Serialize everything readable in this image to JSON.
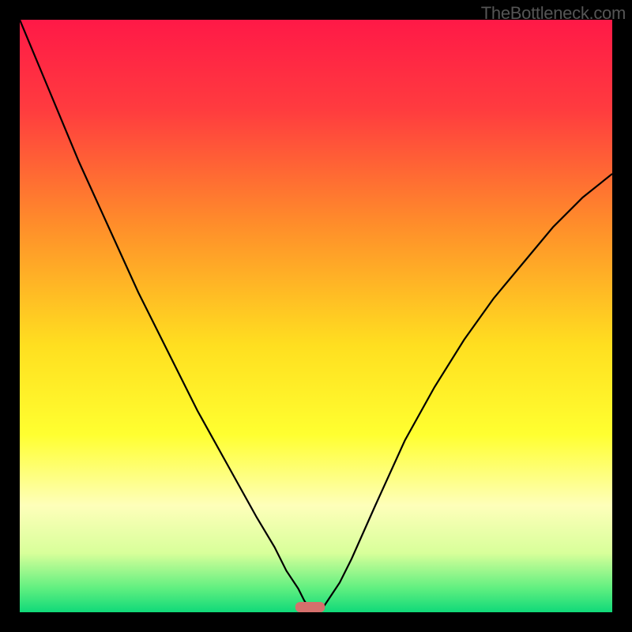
{
  "watermark": "TheBottleneck.com",
  "chart_data": {
    "type": "line",
    "title": "",
    "xlabel": "",
    "ylabel": "",
    "xlim": [
      0,
      100
    ],
    "ylim": [
      0,
      100
    ],
    "background_gradient": {
      "stops": [
        {
          "offset": 0,
          "color": "#ff1947"
        },
        {
          "offset": 15,
          "color": "#ff3b3f"
        },
        {
          "offset": 35,
          "color": "#ff8f2a"
        },
        {
          "offset": 55,
          "color": "#ffdf20"
        },
        {
          "offset": 70,
          "color": "#ffff30"
        },
        {
          "offset": 82,
          "color": "#feffba"
        },
        {
          "offset": 90,
          "color": "#d8ff9a"
        },
        {
          "offset": 96,
          "color": "#5fef80"
        },
        {
          "offset": 100,
          "color": "#10d979"
        }
      ]
    },
    "series": [
      {
        "name": "bottleneck-curve",
        "color": "#000000",
        "x": [
          0,
          5,
          10,
          15,
          20,
          25,
          30,
          35,
          40,
          43,
          45,
          47,
          48,
          49,
          50,
          51,
          52,
          54,
          56,
          60,
          65,
          70,
          75,
          80,
          85,
          90,
          95,
          100
        ],
        "y": [
          100,
          88,
          76,
          65,
          54,
          44,
          34,
          25,
          16,
          11,
          7,
          4,
          2,
          0.5,
          0,
          0.5,
          2,
          5,
          9,
          18,
          29,
          38,
          46,
          53,
          59,
          65,
          70,
          74
        ]
      }
    ],
    "marker": {
      "name": "optimal-point",
      "x": 49,
      "width": 5,
      "y": 0,
      "color": "#d6706c"
    }
  }
}
